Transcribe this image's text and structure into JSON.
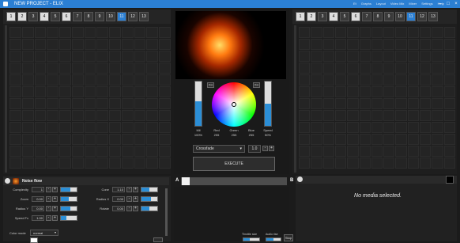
{
  "app": {
    "title": "NEW PROJECT - ELIX",
    "menu": [
      "Et",
      "Graphs",
      "Layout",
      "Video Mix",
      "Mixer",
      "Settings",
      "Help"
    ]
  },
  "left_deck": {
    "toolbar": [
      "1",
      "2",
      "3",
      "4",
      "5",
      "6",
      "7",
      "8",
      "9",
      "10",
      "11",
      "12",
      "13"
    ],
    "active_index": 10,
    "scroll_label": "1"
  },
  "right_deck": {
    "toolbar": [
      "1",
      "2",
      "3",
      "4",
      "5",
      "6",
      "7",
      "8",
      "9",
      "10",
      "11",
      "12",
      "13"
    ],
    "active_index": 10,
    "scroll_label": "1"
  },
  "color": {
    "hue_box_label": "Hue",
    "speed_box_label": "Hue",
    "bars": [
      {
        "name": "Mil",
        "value": "100%",
        "fill": 0.55
      },
      {
        "name": "Speed",
        "value": "50%",
        "fill": 0.5
      }
    ],
    "rgb": [
      {
        "name": "Red",
        "value": "255"
      },
      {
        "name": "Green",
        "value": "255"
      },
      {
        "name": "Blue",
        "value": "255"
      }
    ],
    "mil_label": "Mil",
    "mil_value": "100%",
    "speed_label": "Speed",
    "speed_value": "50%"
  },
  "crossfade": {
    "mode": "Crossfade",
    "time": "1.0",
    "execute_label": "EXECUTE",
    "a_label": "A",
    "b_label": "B",
    "position": 0.08
  },
  "fx": {
    "name": "Noise flow",
    "params_left": [
      {
        "label": "Complexity",
        "value": "1",
        "fill": 0.6
      },
      {
        "label": "Zoom",
        "value": "0.00",
        "fill": 0.5
      },
      {
        "label": "Radius Y",
        "value": "0.00",
        "fill": 0.6
      },
      {
        "label": "Speed Fx",
        "value": "1.00",
        "fill": 0.35
      }
    ],
    "params_right": [
      {
        "label": "Cone",
        "value": "1.10",
        "fill": 0.5
      },
      {
        "label": "Radius X",
        "value": "0.00",
        "fill": 0.6
      },
      {
        "label": "Rotate",
        "value": "0.00",
        "fill": 0.5
      }
    ],
    "color_mode_label": "Color mode",
    "color_mode_value": "normal"
  },
  "bottom_center": {
    "left_label": "Throttle size",
    "right_label": "Audio rise",
    "btn": "Stop"
  },
  "right_bottom": {
    "no_media": "No media selected."
  },
  "colors": {
    "accent": "#2b8ed6",
    "titlebar": "#2b7fd3"
  }
}
